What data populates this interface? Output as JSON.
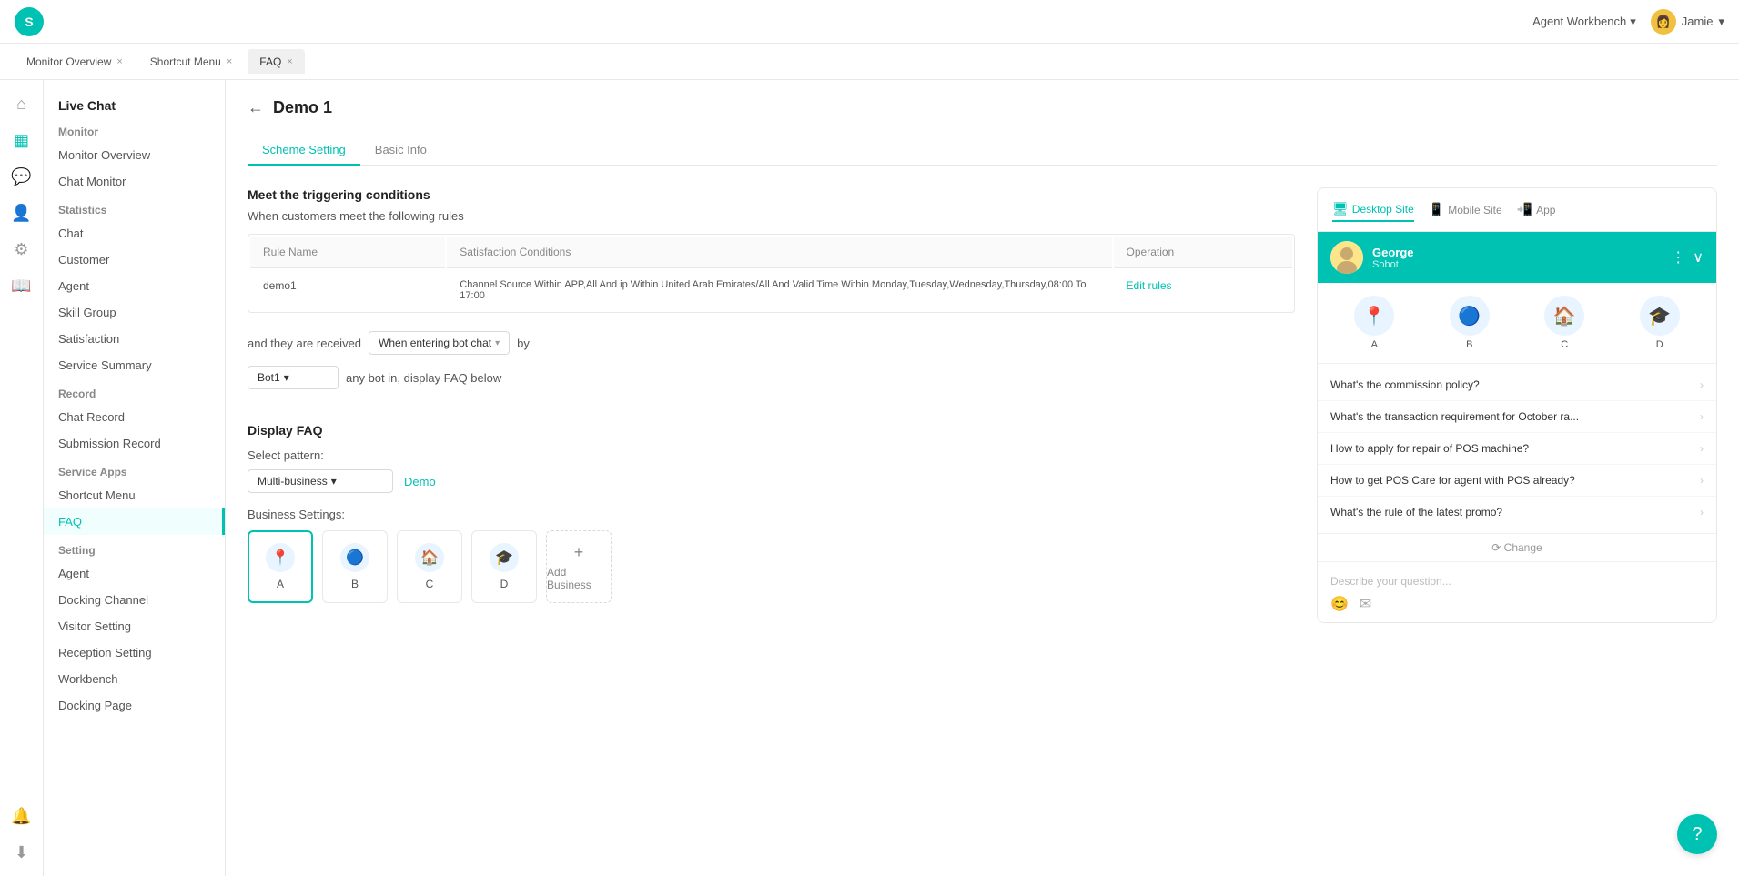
{
  "topbar": {
    "logo": "S",
    "agent_workbench": "Agent Workbench",
    "user": "Jamie",
    "chevron": "▾"
  },
  "tabs": [
    {
      "id": "monitor-overview",
      "label": "Monitor Overview",
      "closable": true
    },
    {
      "id": "shortcut-menu",
      "label": "Shortcut Menu",
      "closable": true
    },
    {
      "id": "faq",
      "label": "FAQ",
      "closable": true,
      "active": true
    }
  ],
  "icon_sidebar": {
    "icons": [
      {
        "id": "home",
        "symbol": "⌂"
      },
      {
        "id": "grid",
        "symbol": "⊞"
      },
      {
        "id": "chat",
        "symbol": "💬"
      },
      {
        "id": "user",
        "symbol": "👤"
      },
      {
        "id": "settings",
        "symbol": "⚙"
      },
      {
        "id": "book",
        "symbol": "📖"
      }
    ]
  },
  "nav": {
    "section_title": "Live Chat",
    "monitor_label": "Monitor",
    "monitor_overview": "Monitor Overview",
    "chat_monitor": "Chat Monitor",
    "statistics_label": "Statistics",
    "chat": "Chat",
    "customer": "Customer",
    "agent": "Agent",
    "skill_group": "Skill Group",
    "satisfaction": "Satisfaction",
    "service_summary": "Service Summary",
    "record_label": "Record",
    "chat_record": "Chat Record",
    "submission_record": "Submission Record",
    "service_apps_label": "Service Apps",
    "shortcut_menu": "Shortcut Menu",
    "faq": "FAQ",
    "setting_label": "Setting",
    "agent_setting": "Agent",
    "docking_channel": "Docking Channel",
    "visitor_setting": "Visitor Setting",
    "reception_setting": "Reception Setting",
    "workbench": "Workbench",
    "docking_page": "Docking Page"
  },
  "page": {
    "back_label": "←",
    "title": "Demo 1",
    "tabs": [
      {
        "id": "scheme-setting",
        "label": "Scheme Setting",
        "active": true
      },
      {
        "id": "basic-info",
        "label": "Basic Info"
      }
    ]
  },
  "scheme": {
    "trigger_heading": "Meet the triggering conditions",
    "trigger_sub": "When customers meet the following rules",
    "table": {
      "headers": [
        "Rule Name",
        "Satisfaction Conditions",
        "Operation"
      ],
      "rows": [
        {
          "rule_name": "demo1",
          "conditions": "Channel Source Within APP,All And ip Within United Arab Emirates/All And Valid Time Within Monday,Tuesday,Wednesday,Thursday,08:00 To 17:00",
          "operation": "Edit rules"
        }
      ]
    },
    "received_label": "and they are received",
    "received_dropdown": "When entering bot chat",
    "received_by": "by",
    "bot_dropdown": "Bot1",
    "bot_suffix": "any bot in, display FAQ below",
    "display_faq_heading": "Display FAQ",
    "select_pattern_label": "Select pattern:",
    "pattern_dropdown": "Multi-business",
    "demo_link": "Demo",
    "business_settings_label": "Business Settings:",
    "business_cards": [
      {
        "id": "A",
        "label": "A",
        "icon": "📍",
        "selected": true,
        "bg": "#e8f4ff"
      },
      {
        "id": "B",
        "label": "B",
        "icon": "🔵",
        "selected": false,
        "bg": "#e8f4ff"
      },
      {
        "id": "C",
        "label": "C",
        "icon": "🏠",
        "selected": false,
        "bg": "#e8f4ff"
      },
      {
        "id": "D",
        "label": "D",
        "icon": "🎓",
        "selected": false,
        "bg": "#e8f4ff"
      }
    ],
    "add_business_label": "Add Business",
    "add_icon": "+"
  },
  "preview": {
    "tabs": [
      {
        "id": "desktop",
        "label": "Desktop Site",
        "icon": "🖥",
        "active": true
      },
      {
        "id": "mobile",
        "label": "Mobile Site",
        "icon": "📱"
      },
      {
        "id": "app",
        "label": "App",
        "icon": "📲"
      }
    ],
    "chat": {
      "avatar": "👤",
      "name": "George",
      "subtitle": "Sobot",
      "menu_icon": "⋮",
      "close_icon": "∨",
      "icons": [
        {
          "id": "A",
          "label": "A",
          "icon": "📍",
          "bg": "#e8f4ff"
        },
        {
          "id": "B",
          "label": "B",
          "icon": "🔵",
          "bg": "#e8f4ff"
        },
        {
          "id": "C",
          "label": "C",
          "icon": "🏠",
          "bg": "#e8f4ff"
        },
        {
          "id": "D",
          "label": "D",
          "icon": "🎓",
          "bg": "#e8f4ff"
        }
      ],
      "faq_items": [
        "What's the commission policy?",
        "What's the transaction requirement for October ra...",
        "How to apply for repair of POS machine?",
        "How to get POS Care for agent with POS already?",
        "What's the rule of the latest promo?"
      ],
      "change_label": "Change",
      "change_icon": "⟳",
      "input_placeholder": "Describe your question...",
      "emoji_icon": "😊",
      "attachment_icon": "✉"
    }
  },
  "help_button": "?"
}
